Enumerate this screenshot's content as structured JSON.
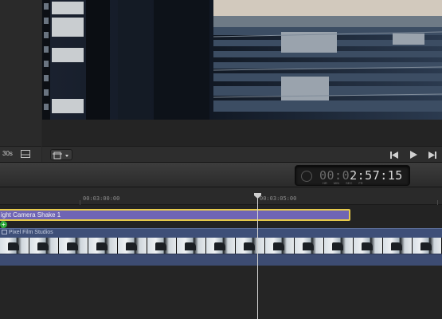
{
  "browser": {
    "duration": "30s",
    "filmstrip_icon": "filmstrip-view-icon"
  },
  "viewer": {
    "transform_icon": "transform-icon",
    "transport": {
      "rewind_icon": "skip-back-icon",
      "play_icon": "play-icon",
      "forward_icon": "skip-forward-icon"
    }
  },
  "dashboard": {
    "timecode_prefix": "00:0",
    "timecode_main": "2:57:15",
    "units": [
      "HR",
      "MIN",
      "SEC",
      "FR"
    ]
  },
  "timeline": {
    "ruler": [
      "00:03:00:00",
      "00:03:05:00"
    ],
    "title_clip": "ight Camera Shake 1",
    "video_clip": "Pixel Film Studios"
  },
  "colors": {
    "title_clip": "#6f64b4",
    "selection": "#e6c94a",
    "video_clip": "#3e4f78",
    "playhead": "#cfcfcf"
  }
}
